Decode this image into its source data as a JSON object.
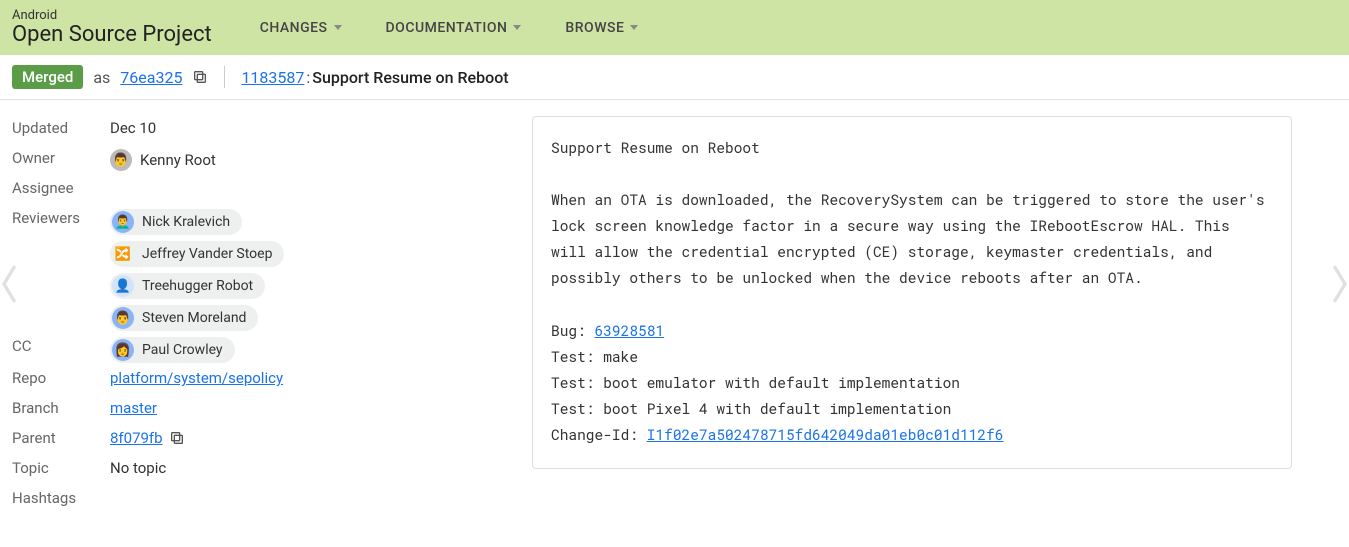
{
  "brand": {
    "top": "Android",
    "bottom": "Open Source Project"
  },
  "nav": {
    "changes": "CHANGES",
    "documentation": "DOCUMENTATION",
    "browse": "BROWSE"
  },
  "subheader": {
    "status": "Merged",
    "as_word": "as",
    "commit_short": "76ea325",
    "change_number": "1183587",
    "sep": ": ",
    "title": "Support Resume on Reboot"
  },
  "meta": {
    "labels": {
      "updated": "Updated",
      "owner": "Owner",
      "assignee": "Assignee",
      "reviewers": "Reviewers",
      "cc": "CC",
      "repo": "Repo",
      "branch": "Branch",
      "parent": "Parent",
      "topic": "Topic",
      "hashtags": "Hashtags"
    },
    "updated": "Dec 10",
    "owner": {
      "name": "Kenny Root",
      "emoji": "👨"
    },
    "assignee": "",
    "reviewers": [
      {
        "name": "Nick Kralevich",
        "emoji": "👨‍🦱"
      },
      {
        "name": "Jeffrey Vander Stoep",
        "emoji": "🔀"
      },
      {
        "name": "Treehugger Robot",
        "emoji": "👤"
      },
      {
        "name": "Steven Moreland",
        "emoji": "👨"
      }
    ],
    "cc": [
      {
        "name": "Paul Crowley",
        "emoji": "👩"
      }
    ],
    "repo": "platform/system/sepolicy",
    "branch": "master",
    "parent": "8f079fb",
    "topic": "No topic",
    "hashtags": ""
  },
  "commit": {
    "title": "Support Resume on Reboot",
    "body": "When an OTA is downloaded, the RecoverySystem can be triggered to store the user's lock screen knowledge factor in a secure way using the IRebootEscrow HAL. This will allow the credential encrypted (CE) storage, keymaster credentials, and possibly others to be unlocked when the device reboots after an OTA.",
    "bug_label": "Bug: ",
    "bug": "63928581",
    "tests": [
      "Test: make",
      "Test: boot emulator with default implementation",
      "Test: boot Pixel 4 with default implementation"
    ],
    "change_id_label": "Change-Id: ",
    "change_id": "I1f02e7a502478715fd642049da01eb0c01d112f6"
  }
}
